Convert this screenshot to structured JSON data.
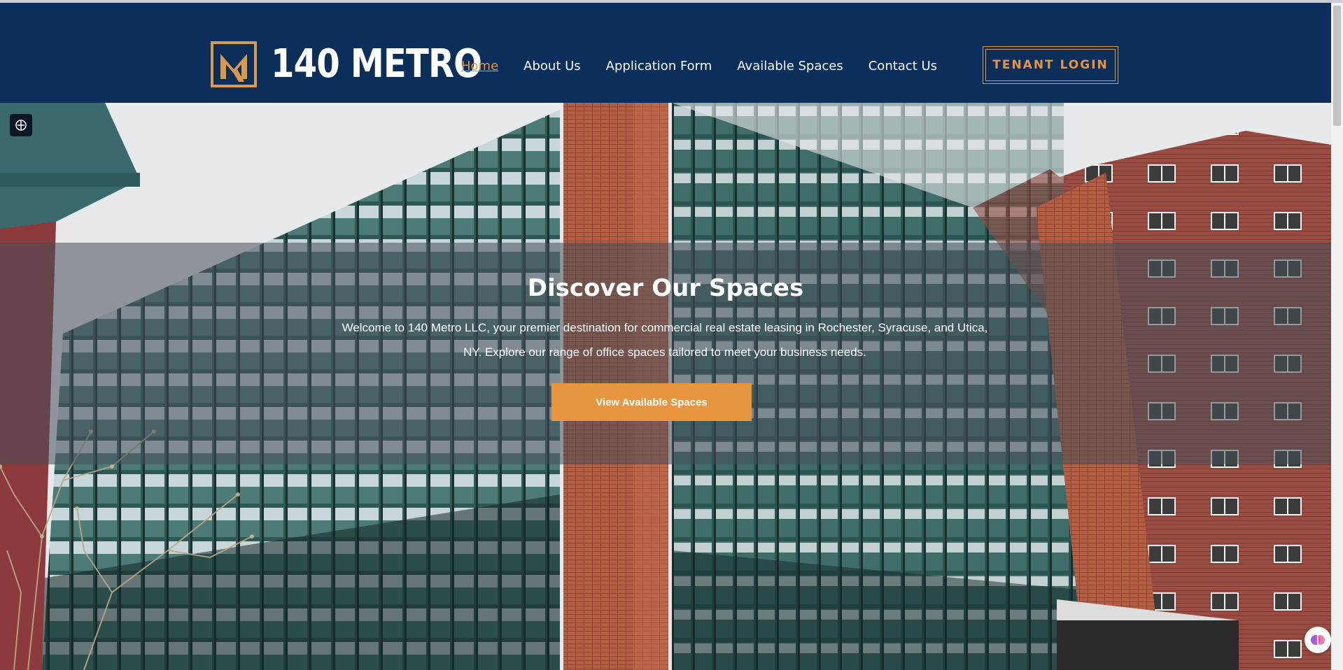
{
  "brand": {
    "name": "140 METRO",
    "accent": "#e7953f",
    "header_bg": "#0b2e5a"
  },
  "nav": [
    {
      "label": "Home",
      "active": true
    },
    {
      "label": "About Us"
    },
    {
      "label": "Application Form"
    },
    {
      "label": "Available Spaces"
    },
    {
      "label": "Contact Us"
    }
  ],
  "tenant_login_label": "TENANT LOGIN",
  "hero": {
    "title": "Discover Our Spaces",
    "description": "Welcome to 140 Metro LLC, your premier destination for commercial real estate leasing in Rochester, Syracuse, and Utica, NY. Explore our range of office spaces tailored to meet your business needs.",
    "cta_label": "View Available Spaces"
  },
  "icons": {
    "left_widget": "accessibility-icon",
    "right_widget": "ai-assistant-icon"
  }
}
